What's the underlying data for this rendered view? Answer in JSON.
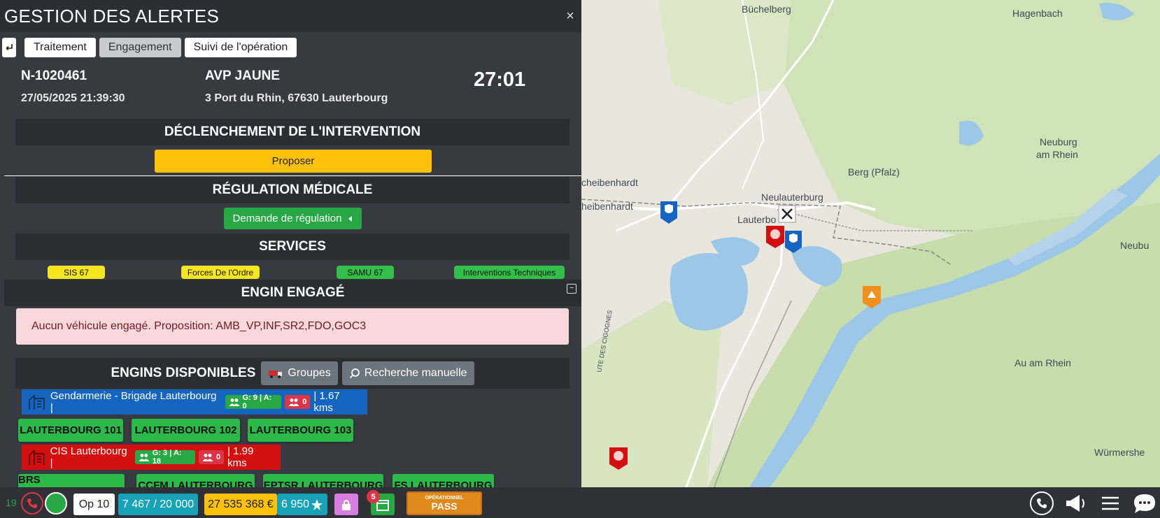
{
  "window": {
    "title": "GESTION DES ALERTES",
    "close_label": "×"
  },
  "tabs": [
    {
      "label": "Traitement",
      "active": false
    },
    {
      "label": "Engagement",
      "active": true
    },
    {
      "label": "Suivi de l'opération",
      "active": false
    }
  ],
  "mission": {
    "number": "N-1020461",
    "datetime": "27/05/2025 21:39:30",
    "type": "AVP JAUNE",
    "address": "3 Port du Rhin, 67630 Lauterbourg",
    "timer": "27:01"
  },
  "sections": {
    "trigger_title": "DÉCLENCHEMENT DE L'INTERVENTION",
    "propose_label": "Proposer",
    "medical_title": "RÉGULATION MÉDICALE",
    "regulation_label": "Demande de régulation",
    "services_title": "SERVICES",
    "engaged_title": "ENGIN ENGAGÉ",
    "available_title": "ENGINS DISPONIBLES"
  },
  "services": [
    {
      "label": "SIS 67",
      "color": "#f5e61f"
    },
    {
      "label": "Forces De l'Ordre",
      "color": "#f5e61f"
    },
    {
      "label": "SAMU 67",
      "color": "#33c04a"
    },
    {
      "label": "Interventions Techniques",
      "color": "#33c04a"
    }
  ],
  "engaged_alert": "Aucun véhicule engagé. Proposition: AMB_VP,INF,SR2,FDO,GOC3",
  "available_buttons": {
    "groups": "Groupes",
    "manual_search": "Recherche manuelle"
  },
  "stations": [
    {
      "name": "Gendarmerie - Brigade Lauterbourg |",
      "staff": "G: 9 | A: 0",
      "busy": "0",
      "distance": "| 1.67 kms",
      "color": "#1565c0",
      "vehicles": [
        "LAUTERBOURG 101",
        "LAUTERBOURG 102",
        "LAUTERBOURG 103"
      ]
    },
    {
      "name": "CIS Lauterbourg |",
      "staff": "G: 3 | A: 18",
      "busy": "0",
      "distance": "| 1.99 kms",
      "color": "#d30f0f",
      "vehicles": [
        "BRS LAUTERBOURG",
        "CCFM LAUTERBOURG",
        "EPTSR LAUTERBOURG",
        "FS LAUTERBOURG"
      ]
    }
  ],
  "map": {
    "labels": [
      "Büchelberg",
      "Hagenbach",
      "Neuburg",
      "am Rhein",
      "Berg (Pfalz)",
      "Neulauterburg",
      "Lauterbo",
      "cheibenhardt",
      "heibenhardt",
      "Neubu",
      "Au am Rhein",
      "Würmershe",
      "UTE DES CIGOGNES"
    ],
    "water_color": "#9cc7e6",
    "green_color": "#c9dfb0"
  },
  "bottom": {
    "call_count": "19",
    "op_label": "Op 10",
    "credits": "7 467 / 20 000",
    "money": "27 535 368 €",
    "stars": "6 950",
    "calendar_badge": "5",
    "pass_top": "OPÉRATIONNEL",
    "pass_bottom": "PASS"
  }
}
